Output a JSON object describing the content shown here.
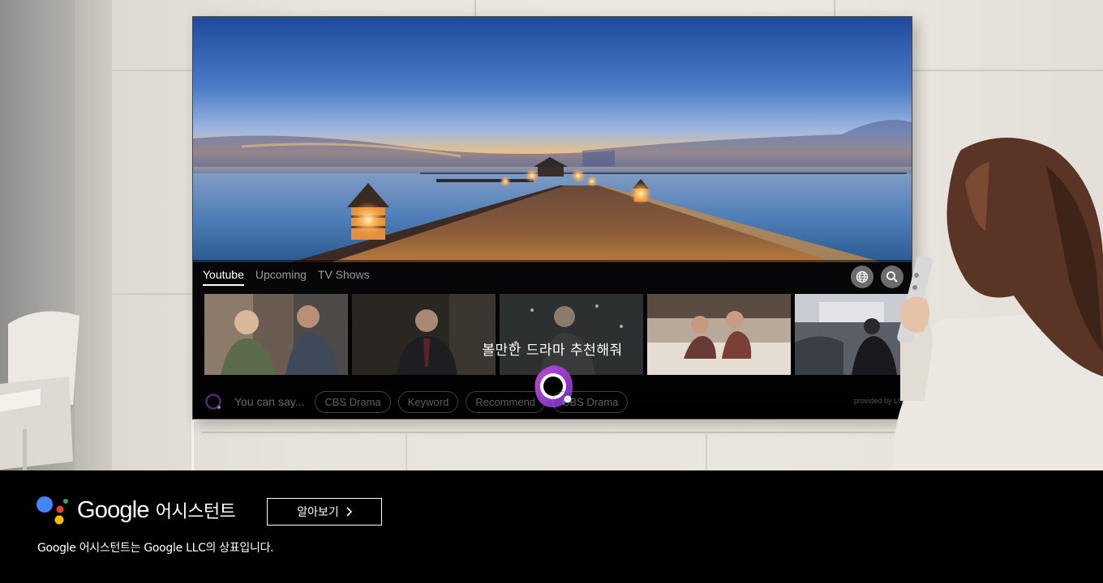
{
  "tv_ui": {
    "tabs": [
      {
        "label": "Youtube",
        "active": true
      },
      {
        "label": "Upcoming",
        "active": false
      },
      {
        "label": "TV Shows",
        "active": false
      }
    ],
    "voice_query": "볼만한 드라마 추천해줘",
    "you_can_say": "You can say...",
    "suggestion_chips": [
      "CBS Drama",
      "Keyword",
      "Recommend",
      "CBS Drama"
    ],
    "provided_by": "provided by LG",
    "icons": [
      "globe-icon",
      "search-icon"
    ]
  },
  "banner": {
    "brand_name": "Google",
    "product_name": "어시스턴트",
    "learn_more_label": "알아보기",
    "trademark_notice": "Google 어시스턴트는 Google LLC의 상표입니다.",
    "colors": {
      "blue": "#4285F4",
      "red": "#EA4335",
      "yellow": "#FBBC05",
      "green": "#34A853"
    }
  }
}
